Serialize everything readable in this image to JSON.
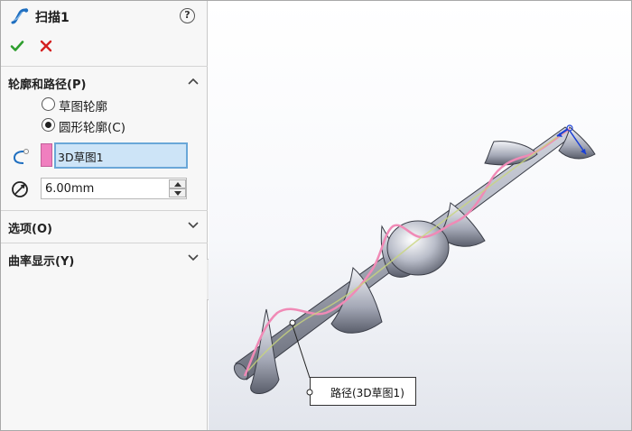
{
  "panel": {
    "title": "扫描1",
    "help_label": "?"
  },
  "sections": {
    "profile_and_path": {
      "label": "轮廓和路径(P)",
      "options": [
        {
          "label": "草图轮廓",
          "selected": false
        },
        {
          "label": "圆形轮廓(C)",
          "selected": true
        }
      ],
      "path_selection": "3D草图1",
      "path_color": "#f07fbf",
      "diameter_value": "6.00mm"
    },
    "options": {
      "label": "选项(O)"
    },
    "curvature_display": {
      "label": "曲率显示(Y)"
    }
  },
  "viewport": {
    "callout_label": "路径(3D草图1)"
  },
  "colors": {
    "ok_green": "#2e9e2e",
    "cancel_red": "#d42020",
    "feature_blue": "#1f6fc0"
  }
}
